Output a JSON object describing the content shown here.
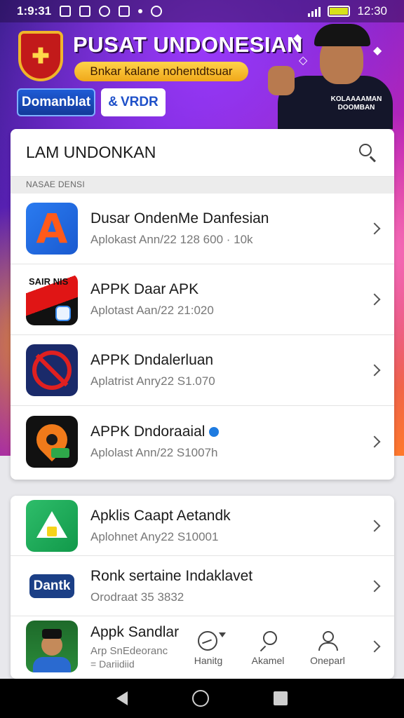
{
  "status_bar": {
    "time": "1:9:31",
    "clock_right": "12:30",
    "icons": [
      "gallery-icon",
      "clipboard-icon",
      "wifi-icon",
      "shield-icon",
      "dot-icon",
      "settings-icon",
      "signal-icon",
      "battery-icon"
    ]
  },
  "banner": {
    "title": "PUSAT UNDONESIAN",
    "pill": "Bnkar kalane nohentdtsuar",
    "btn_primary": "Domanblat",
    "btn_secondary": "VRDR",
    "shirt_text": "KOLAAAAMAN DOOMBAN"
  },
  "search": {
    "title": "LAM UNDONKAN",
    "section_label": "NASAE DENSI"
  },
  "apps_card1": [
    {
      "title": "Dusar OndenMe Danfesian",
      "sub": "Aplokast Ann/22  128 600 · 10k"
    },
    {
      "title": "APPK Daar APK",
      "sub": "Aplotast Aan/22  21:020"
    },
    {
      "title": "APPK Dndalerluan",
      "sub": "Aplatrist Anry22  S1.070"
    },
    {
      "title": "APPK Dndoraaial",
      "sub": "Aplolast Ann/22  S1007h"
    }
  ],
  "apps_card2": [
    {
      "title": "Apklis Caapt Aetandk",
      "sub": "Aplohnet Any22  S10001"
    },
    {
      "title": "Ronk sertaine Indaklavet",
      "sub": "Orodraat 35 3832"
    },
    {
      "title": "Appk Sandlar",
      "sub": "Arp SnEdeoranc",
      "sub2": "= Dariidiid"
    }
  ],
  "icon_labels": {
    "app1": "A",
    "app2_banner": "SAIR NIS",
    "app6": "Dantk"
  },
  "tabs": [
    {
      "label": "Hanitg",
      "icon": "clock-icon"
    },
    {
      "label": "Akamel",
      "icon": "search-icon"
    },
    {
      "label": "Oneparl",
      "icon": "profile-icon"
    }
  ],
  "colors": {
    "accent": "#1e50c8",
    "pill": "#f0a81a"
  }
}
